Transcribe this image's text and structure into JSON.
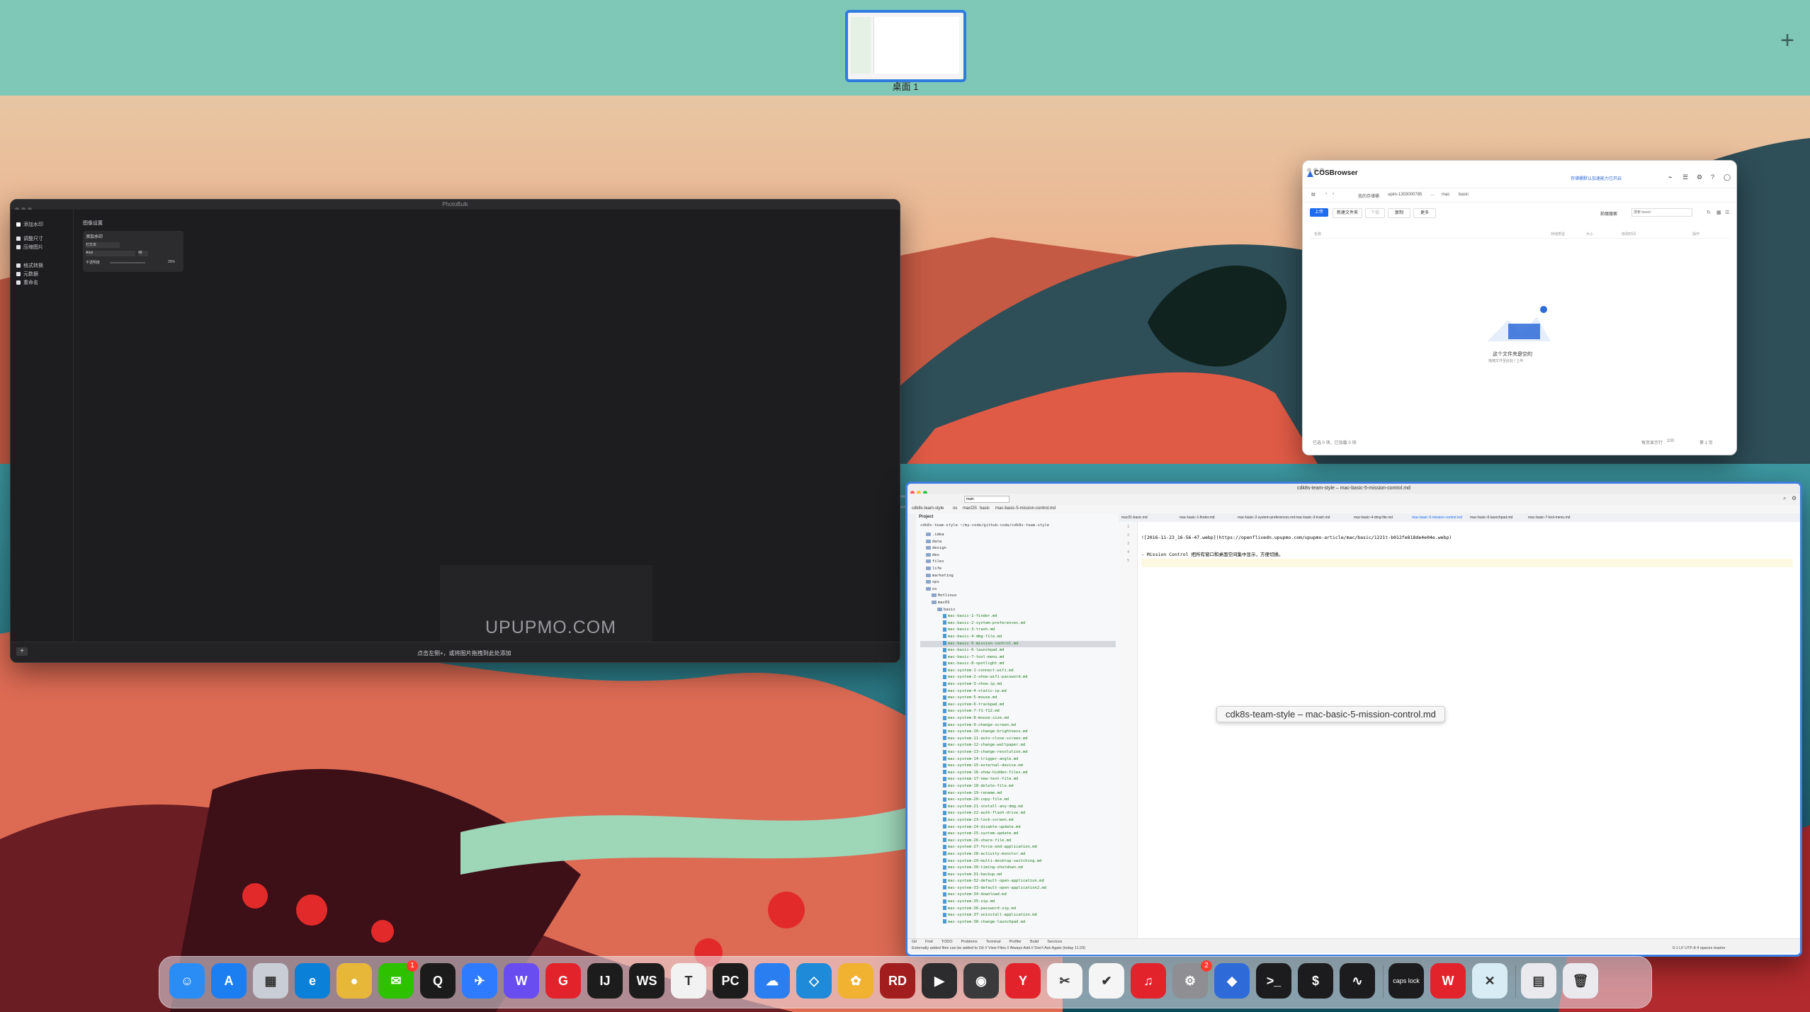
{
  "mission_control": {
    "space_label": "桌面 1",
    "add_space_symbol": "+"
  },
  "photobulk": {
    "title": "PhotoBulk",
    "sidebar": {
      "items": [
        "添加水印",
        "调整尺寸",
        "压缩图片",
        "格式转换",
        "元数据",
        "重命名"
      ]
    },
    "panel_tab": "图像设置",
    "panel_header": "添加水印",
    "panel_type": "打文本",
    "font": "Arial",
    "font_size": "48",
    "opacity_label": "不透明度",
    "opacity_value": "25%",
    "watermark_text": "UPUPMO.COM",
    "bottom_hint": "点击左侧+，或将图片拖拽到此处添加",
    "add_symbol": "+"
  },
  "cosbrowser": {
    "brand": "COSBrowser",
    "notice": "存储桶默认加速能力已开启",
    "path": [
      "我的存储桶",
      "upim-1303000785",
      "…",
      "mac",
      "basic"
    ],
    "buttons": [
      "上传",
      "新建文件夹",
      "下载",
      "复制",
      "更多"
    ],
    "filter_label": "前缀搜索",
    "search_placeholder": "搜索 basic/",
    "columns": [
      "名称",
      "存储类型",
      "大小",
      "修改时间",
      "操作"
    ],
    "empty_title": "这个文件夹是空的",
    "empty_sub": "拖拽文件至此处 / 上传",
    "footer_left": "已选 0 项，已加载 0 项",
    "footer_right": "每页显示行",
    "page_size": "100",
    "page_num": "第 1 页"
  },
  "idea": {
    "title": "cdk8s-team-style – mac-basic-5-mission-control.md",
    "branch": "main",
    "breadcrumb": [
      "cdk8s-team-style",
      "os",
      "macOS",
      "basic",
      "mac-basic-5-mission-control.md"
    ],
    "project_label": "Project",
    "project_root": "cdk8s-team-style ~/my-code/github-code/cdk8s-team-style",
    "tree": [
      {
        "name": ".idea",
        "type": "folder",
        "depth": 1
      },
      {
        "name": "data",
        "type": "folder",
        "depth": 1
      },
      {
        "name": "design",
        "type": "folder",
        "depth": 1
      },
      {
        "name": "dev",
        "type": "folder",
        "depth": 1
      },
      {
        "name": "files",
        "type": "folder",
        "depth": 1
      },
      {
        "name": "life",
        "type": "folder",
        "depth": 1
      },
      {
        "name": "marketing",
        "type": "folder",
        "depth": 1
      },
      {
        "name": "ops",
        "type": "folder",
        "depth": 1
      },
      {
        "name": "os",
        "type": "folder",
        "depth": 1
      },
      {
        "name": "Hotlinux",
        "type": "folder",
        "depth": 2
      },
      {
        "name": "macOS",
        "type": "folder",
        "depth": 2
      },
      {
        "name": "basic",
        "type": "folder",
        "depth": 3
      },
      {
        "name": "mac-basic-1-finder.md",
        "type": "file",
        "depth": 4
      },
      {
        "name": "mac-basic-2-system-preferences.md",
        "type": "file",
        "depth": 4
      },
      {
        "name": "mac-basic-3-trash.md",
        "type": "file",
        "depth": 4
      },
      {
        "name": "mac-basic-4-dmg-file.md",
        "type": "file",
        "depth": 4
      },
      {
        "name": "mac-basic-5-mission-control.md",
        "type": "file",
        "depth": 4,
        "selected": true
      },
      {
        "name": "mac-basic-6-launchpad.md",
        "type": "file",
        "depth": 4
      },
      {
        "name": "mac-basic-7-tool-menu.md",
        "type": "file",
        "depth": 4
      },
      {
        "name": "mac-basic-8-spotlight.md",
        "type": "file",
        "depth": 4
      },
      {
        "name": "mac-system-1-connect-wifi.md",
        "type": "file",
        "depth": 4
      },
      {
        "name": "mac-system-2-show-wifi-password.md",
        "type": "file",
        "depth": 4
      },
      {
        "name": "mac-system-3-show-ip.md",
        "type": "file",
        "depth": 4
      },
      {
        "name": "mac-system-4-static-ip.md",
        "type": "file",
        "depth": 4
      },
      {
        "name": "mac-system-5-mouse.md",
        "type": "file",
        "depth": 4
      },
      {
        "name": "mac-system-6-trackpad.md",
        "type": "file",
        "depth": 4
      },
      {
        "name": "mac-system-7-f1-f12.md",
        "type": "file",
        "depth": 4
      },
      {
        "name": "mac-system-8-mouse-size.md",
        "type": "file",
        "depth": 4
      },
      {
        "name": "mac-system-9-change-screen.md",
        "type": "file",
        "depth": 4
      },
      {
        "name": "mac-system-10-change-brightness.md",
        "type": "file",
        "depth": 4
      },
      {
        "name": "mac-system-11-auto-close-screen.md",
        "type": "file",
        "depth": 4
      },
      {
        "name": "mac-system-12-change-wallpaper.md",
        "type": "file",
        "depth": 4
      },
      {
        "name": "mac-system-13-change-resolution.md",
        "type": "file",
        "depth": 4
      },
      {
        "name": "mac-system-14-trigger-angle.md",
        "type": "file",
        "depth": 4
      },
      {
        "name": "mac-system-15-external-device.md",
        "type": "file",
        "depth": 4
      },
      {
        "name": "mac-system-16-show-hidden-files.md",
        "type": "file",
        "depth": 4
      },
      {
        "name": "mac-system-17-new-text-file.md",
        "type": "file",
        "depth": 4
      },
      {
        "name": "mac-system-18-delete-file.md",
        "type": "file",
        "depth": 4
      },
      {
        "name": "mac-system-19-rename.md",
        "type": "file",
        "depth": 4
      },
      {
        "name": "mac-system-20-copy-file.md",
        "type": "file",
        "depth": 4
      },
      {
        "name": "mac-system-21-install-any-dmg.md",
        "type": "file",
        "depth": 4
      },
      {
        "name": "mac-system-22-auth-flash-drive.md",
        "type": "file",
        "depth": 4
      },
      {
        "name": "mac-system-23-lock-screen.md",
        "type": "file",
        "depth": 4
      },
      {
        "name": "mac-system-24-disable-update.md",
        "type": "file",
        "depth": 4
      },
      {
        "name": "mac-system-25-system-update.md",
        "type": "file",
        "depth": 4
      },
      {
        "name": "mac-system-26-share-file.md",
        "type": "file",
        "depth": 4
      },
      {
        "name": "mac-system-27-force-end-application.md",
        "type": "file",
        "depth": 4
      },
      {
        "name": "mac-system-28-activity-monitor.md",
        "type": "file",
        "depth": 4
      },
      {
        "name": "mac-system-29-multi-desktop-switching.md",
        "type": "file",
        "depth": 4
      },
      {
        "name": "mac-system-30-timing-shutdown.md",
        "type": "file",
        "depth": 4
      },
      {
        "name": "mac-system-31-backup.md",
        "type": "file",
        "depth": 4
      },
      {
        "name": "mac-system-32-default-open-application.md",
        "type": "file",
        "depth": 4
      },
      {
        "name": "mac-system-33-default-open-application2.md",
        "type": "file",
        "depth": 4
      },
      {
        "name": "mac-system-34-download.md",
        "type": "file",
        "depth": 4
      },
      {
        "name": "mac-system-35-zip.md",
        "type": "file",
        "depth": 4
      },
      {
        "name": "mac-system-36-password-zip.md",
        "type": "file",
        "depth": 4
      },
      {
        "name": "mac-system-37-uninstall-application.md",
        "type": "file",
        "depth": 4
      },
      {
        "name": "mac-system-38-change-launchpad.md",
        "type": "file",
        "depth": 4
      }
    ],
    "tabs": [
      "mac01-basic.md",
      "mac-basic-1-finder.md",
      "mac-basic-2-system-preferences.md",
      "mac-basic-3-trash.md",
      "mac-basic-4-dmg-file.md",
      "mac-basic-5-mission-control.md",
      "mac-basic-6-launchpad.md",
      "mac-basic-7-tool-menu.md"
    ],
    "editor_lines": [
      "",
      "![2016-11-23_16-56-47.webp](https://openflixedn.upupmo.com/upupmo-article/mac/basic/1221t-b012fe818de4e04e.webp)",
      "",
      "- Mission Control 把所有窗口和桌面空间集中显示，方便切换。",
      ""
    ],
    "bottom_tabs": [
      "Git",
      "Find",
      "TODO",
      "Problems",
      "Terminal",
      "Profiler",
      "Build",
      "Services"
    ],
    "status_text": "Externally added files can be added to Git // View Files // Always Add // Don't Ask Again (today 11:29)",
    "status_right": "5:1  LF  UTF-8  4 spaces  master",
    "tooltip": "cdk8s-team-style – mac-basic-5-mission-control.md"
  },
  "background_watermark": "UPUPMO.COM",
  "dock": {
    "apps": [
      {
        "name": "finder",
        "glyph": "☺",
        "color": "#2a8df5"
      },
      {
        "name": "app-store",
        "glyph": "A",
        "color": "#1b7ff2"
      },
      {
        "name": "launchpad",
        "glyph": "▦",
        "color": "#c9ced6"
      },
      {
        "name": "edge",
        "glyph": "e",
        "color": "#0b80d8"
      },
      {
        "name": "chrome",
        "glyph": "●",
        "color": "#e7b73a"
      },
      {
        "name": "wechat",
        "glyph": "✉",
        "color": "#2dc100",
        "badge": "1"
      },
      {
        "name": "qq",
        "glyph": "Q",
        "color": "#1b1b1b"
      },
      {
        "name": "feishu",
        "glyph": "✈",
        "color": "#2f7bff"
      },
      {
        "name": "wps-writer",
        "glyph": "W",
        "color": "#6a4df0"
      },
      {
        "name": "git-client",
        "glyph": "G",
        "color": "#e3232b"
      },
      {
        "name": "intellij-idea",
        "glyph": "IJ",
        "color": "#1c1c1c"
      },
      {
        "name": "webstorm",
        "glyph": "WS",
        "color": "#1c1c1c"
      },
      {
        "name": "typora",
        "glyph": "T",
        "color": "#f2f2f2"
      },
      {
        "name": "pycharm",
        "glyph": "PC",
        "color": "#1c1c1c"
      },
      {
        "name": "baidu-netdisk",
        "glyph": "☁",
        "color": "#2a7ef0"
      },
      {
        "name": "vscode",
        "glyph": "◇",
        "color": "#1f8ad8"
      },
      {
        "name": "navicat",
        "glyph": "✿",
        "color": "#f1b232"
      },
      {
        "name": "redis-desktop",
        "glyph": "RD",
        "color": "#a21d1d"
      },
      {
        "name": "final-cut-pro",
        "glyph": "▶",
        "color": "#2c2c2e"
      },
      {
        "name": "compressor",
        "glyph": "◉",
        "color": "#3a3a3c"
      },
      {
        "name": "youdao",
        "glyph": "Y",
        "color": "#e3232b"
      },
      {
        "name": "snipaste",
        "glyph": "✂",
        "color": "#f5f5f5"
      },
      {
        "name": "ticktick",
        "glyph": "✔",
        "color": "#f5f5f5"
      },
      {
        "name": "netease-music",
        "glyph": "♫",
        "color": "#e3232b"
      },
      {
        "name": "system-preferences",
        "glyph": "⚙",
        "color": "#8e8e93",
        "badge": "2"
      },
      {
        "name": "cosbrowser",
        "glyph": "◆",
        "color": "#2f6bd8"
      },
      {
        "name": "terminal",
        "glyph": ">_",
        "color": "#1c1c1e"
      },
      {
        "name": "iterm",
        "glyph": "$",
        "color": "#1c1c1e"
      },
      {
        "name": "activity-monitor",
        "glyph": "∿",
        "color": "#1c1c1e"
      },
      {
        "name": "caps-lock",
        "glyph": "caps lock",
        "color": "#1c1c1e"
      },
      {
        "name": "wps",
        "glyph": "W",
        "color": "#e3232b"
      },
      {
        "name": "xmind",
        "glyph": "✕",
        "color": "#d8ecf5"
      },
      {
        "name": "stack",
        "glyph": "▤",
        "color": "#e9e9ee"
      },
      {
        "name": "trash",
        "glyph": "🗑",
        "color": "#e9e9ee"
      }
    ]
  }
}
